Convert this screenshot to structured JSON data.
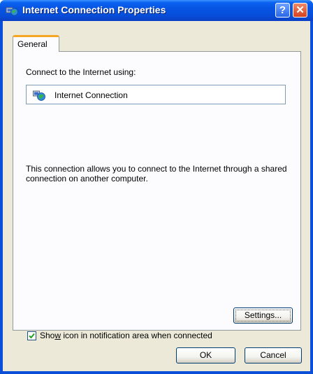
{
  "window": {
    "title": "Internet Connection Properties",
    "help_label": "?",
    "close_label": "✕"
  },
  "tabs": [
    {
      "label": "General",
      "active": true
    }
  ],
  "general": {
    "connect_label": "Connect to the Internet using:",
    "connection_name": "Internet Connection",
    "connection_icon": "network-globe-icon",
    "description": "This connection allows you to connect to the Internet through a shared connection on another computer.",
    "settings_button": "Settings...",
    "show_icon_checkbox": {
      "label_prefix": "Sho",
      "label_accel": "w",
      "label_suffix": " icon in notification area when connected",
      "checked": true
    }
  },
  "footer": {
    "ok_label": "OK",
    "cancel_label": "Cancel"
  },
  "colors": {
    "titlebar": "#0a4fd8",
    "dialog_bg": "#ece9d8",
    "panel_bg": "#fcfcfe",
    "tab_accent": "#f5a623",
    "check_mark": "#21a121"
  }
}
